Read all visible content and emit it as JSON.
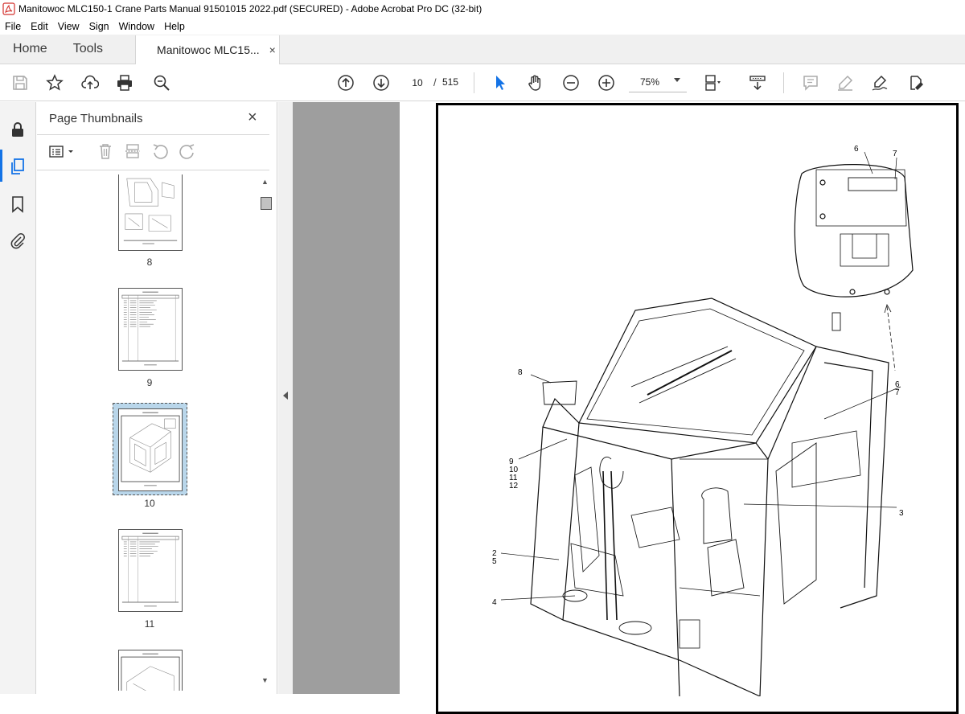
{
  "window": {
    "title": "Manitowoc MLC150-1 Crane Parts Manual 91501015 2022.pdf (SECURED) - Adobe Acrobat Pro DC (32-bit)"
  },
  "menu": [
    "File",
    "Edit",
    "View",
    "Sign",
    "Window",
    "Help"
  ],
  "tabs": {
    "home": "Home",
    "tools": "Tools",
    "document": "Manitowoc MLC15...",
    "close": "×"
  },
  "toolbar": {
    "current_page": "10",
    "page_separator": "/",
    "total_pages": "515",
    "zoom": "75%"
  },
  "panel": {
    "title": "Page Thumbnails",
    "close": "×",
    "thumbnails": [
      {
        "label": "8"
      },
      {
        "label": "9"
      },
      {
        "label": "10",
        "selected": true
      },
      {
        "label": "11"
      }
    ]
  },
  "drawing_callouts": {
    "c6": "6",
    "c7": "7",
    "c8": "8",
    "c9": "9",
    "c10": "10",
    "c11": "11",
    "c12": "12",
    "c6b": "6",
    "c7b": "7",
    "c3": "3",
    "c2": "2",
    "c5": "5",
    "c4": "4"
  },
  "colors": {
    "accent": "#1473e6",
    "selected_thumb": "#b9d6ea",
    "gutter": "#9e9e9e"
  }
}
